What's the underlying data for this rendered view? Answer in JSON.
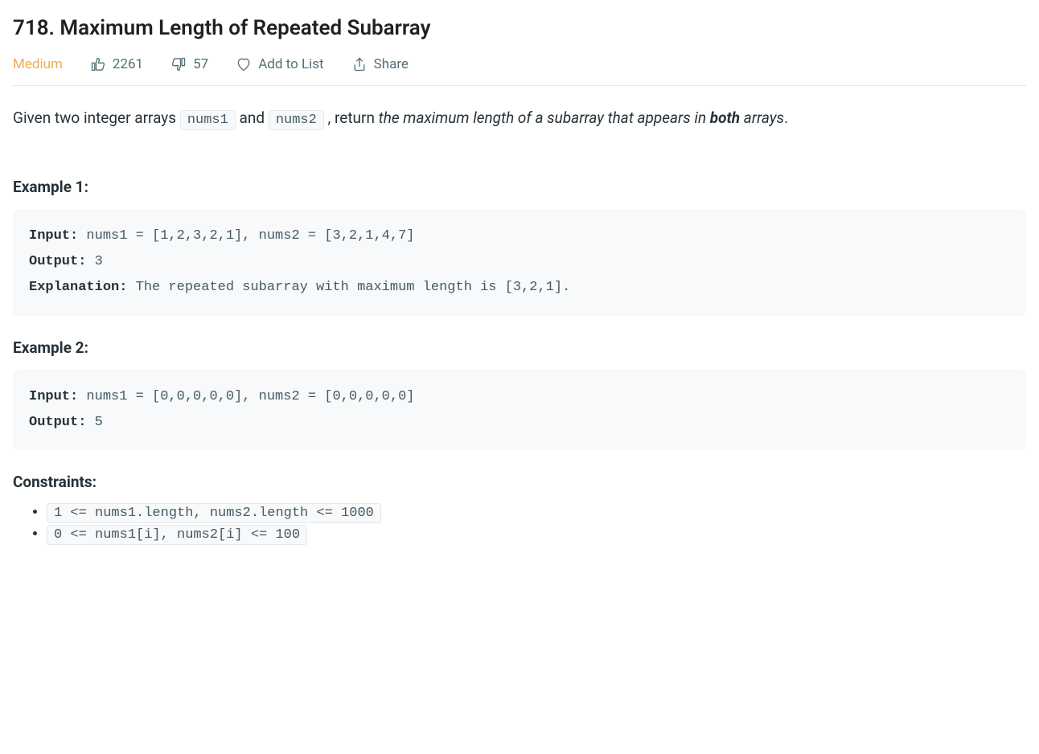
{
  "title": "718. Maximum Length of Repeated Subarray",
  "difficulty": "Medium",
  "likes": "2261",
  "dislikes": "57",
  "add_to_list_label": "Add to List",
  "share_label": "Share",
  "description": {
    "prefix": "Given two integer arrays ",
    "code1": "nums1",
    "mid1": " and ",
    "code2": "nums2",
    "mid2": " , return ",
    "italic_before_bold": "the maximum length of a subarray that appears in ",
    "bold": "both",
    "italic_after_bold": " arrays",
    "suffix": "."
  },
  "example1": {
    "heading": "Example 1:",
    "labels": {
      "input": "Input:",
      "output": "Output:",
      "explanation": "Explanation:"
    },
    "input": " nums1 = [1,2,3,2,1], nums2 = [3,2,1,4,7]",
    "output": " 3",
    "explanation": " The repeated subarray with maximum length is [3,2,1]."
  },
  "example2": {
    "heading": "Example 2:",
    "labels": {
      "input": "Input:",
      "output": "Output:"
    },
    "input": " nums1 = [0,0,0,0,0], nums2 = [0,0,0,0,0]",
    "output": " 5"
  },
  "constraints": {
    "heading": "Constraints:",
    "items": [
      "1 <= nums1.length, nums2.length <= 1000",
      "0 <= nums1[i], nums2[i] <= 100"
    ]
  }
}
